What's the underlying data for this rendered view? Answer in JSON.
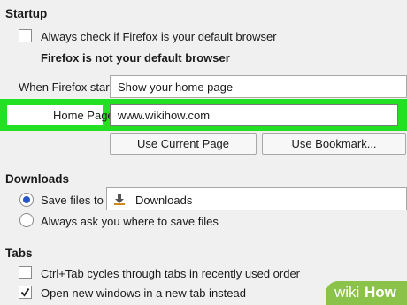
{
  "startup": {
    "heading": "Startup",
    "default_check_label": "Always check if Firefox is your default browser",
    "default_status": "Firefox is not your default browser",
    "when_starts_label": "When Firefox starts:",
    "when_starts_value": "Show your home page",
    "home_page_label": "Home Page:",
    "home_page_value": "www.wikihow.com",
    "use_current_page_label": "Use Current Page",
    "use_bookmark_label": "Use Bookmark..."
  },
  "downloads": {
    "heading": "Downloads",
    "save_files_label": "Save files to",
    "save_folder": "Downloads",
    "always_ask_label": "Always ask you where to save files"
  },
  "tabs": {
    "heading": "Tabs",
    "ctrl_tab_label": "Ctrl+Tab cycles through tabs in recently used order",
    "new_windows_label": "Open new windows in a new tab instead"
  },
  "watermark": {
    "wiki": "wiki",
    "how": "How"
  },
  "colors": {
    "highlight": "#22e022",
    "radio_selected": "#2a55c8",
    "watermark_bg": "#8bc34a"
  }
}
